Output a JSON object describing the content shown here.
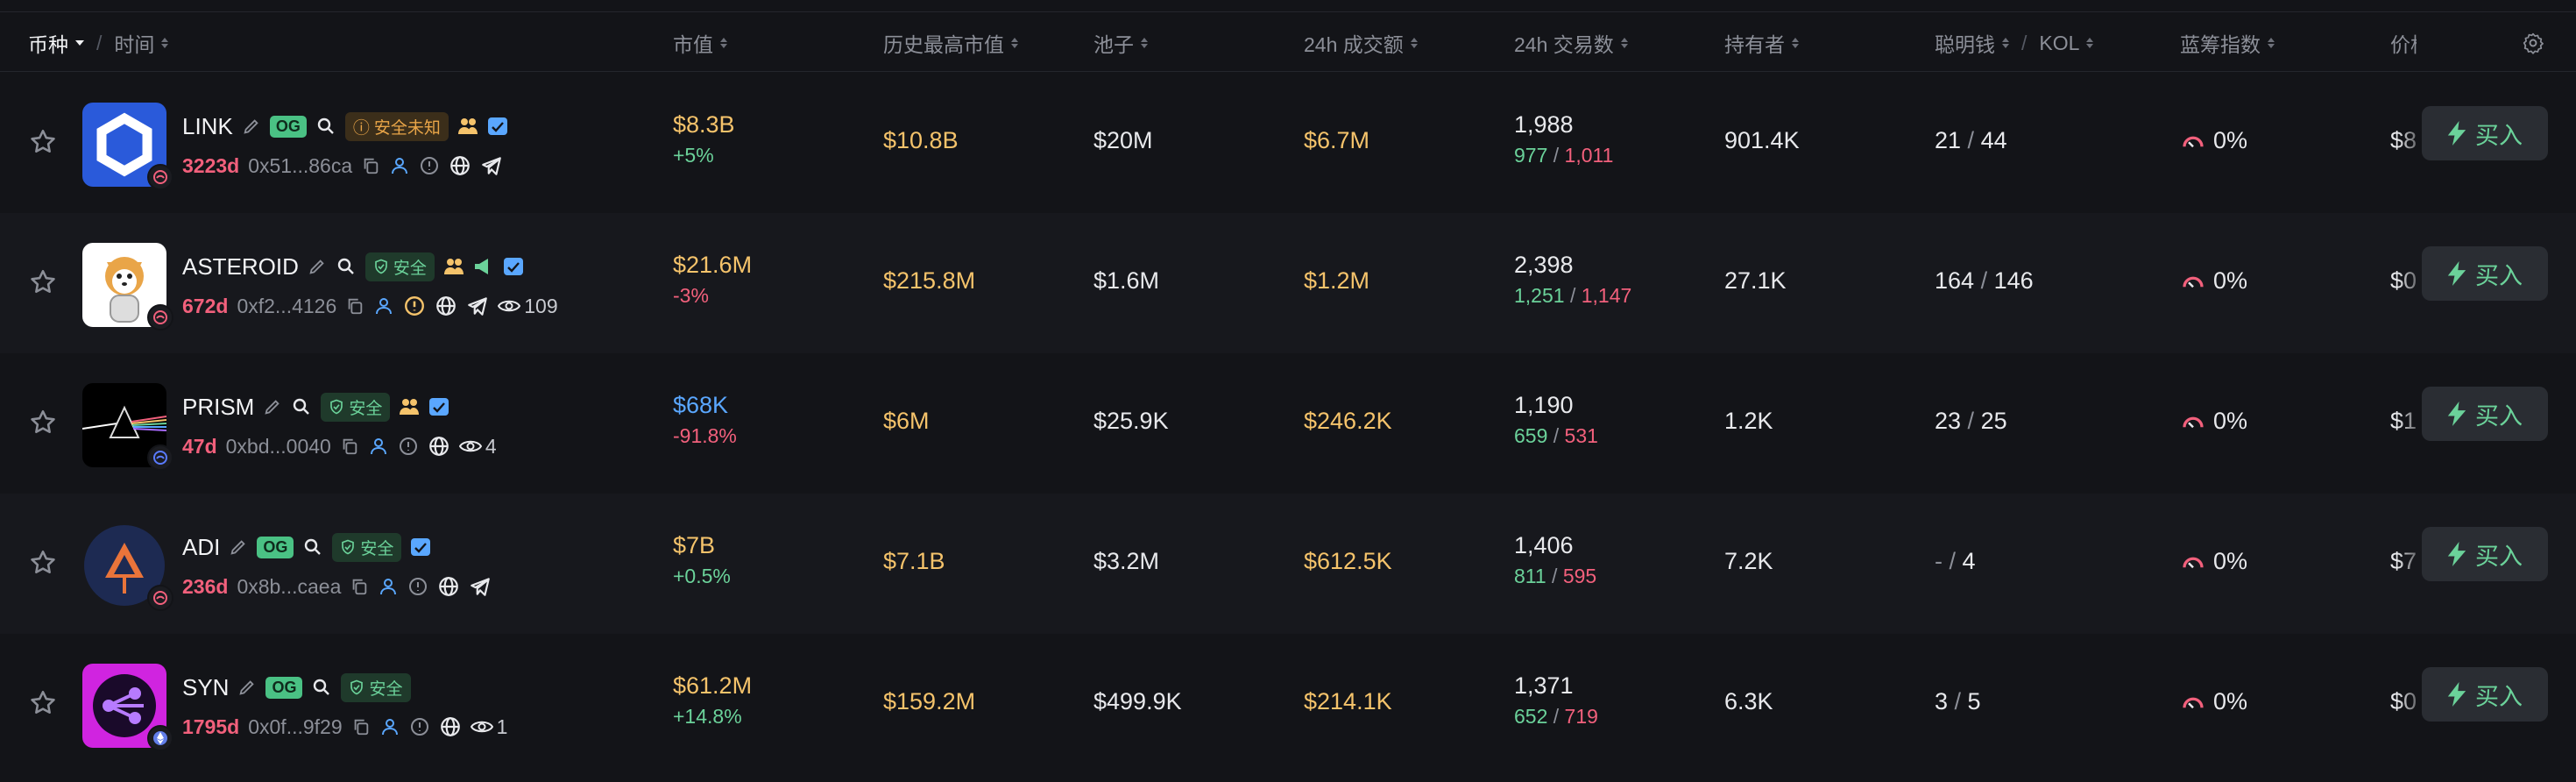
{
  "header": {
    "coin": "币种",
    "time": "时间",
    "slash": "/",
    "mcap": "市值",
    "ath": "历史最高市值",
    "pool": "池子",
    "vol": "24h 成交额",
    "txs": "24h 交易数",
    "holders": "持有者",
    "smart": "聪明钱",
    "kol": "KOL",
    "bluechip": "蓝筹指数",
    "price": "价格"
  },
  "buy_label": "买入",
  "rows": [
    {
      "name": "LINK",
      "og": "OG",
      "security": "安全未知",
      "age": "3223d",
      "addr": "0x51...86ca",
      "mcap": "$8.3B",
      "mcap_change": "+5%",
      "ath": "$10.8B",
      "pool": "$20M",
      "vol": "$6.7M",
      "txs": "1,988",
      "buys": "977",
      "sells": "1,011",
      "holders": "901.4K",
      "smart": "21",
      "kol": "44",
      "bluechip": "0%",
      "price": "$8",
      "views": ""
    },
    {
      "name": "ASTEROID",
      "og": "",
      "security": "安全",
      "age": "672d",
      "addr": "0xf2...4126",
      "mcap": "$21.6M",
      "mcap_change": "-3%",
      "ath": "$215.8M",
      "pool": "$1.6M",
      "vol": "$1.2M",
      "txs": "2,398",
      "buys": "1,251",
      "sells": "1,147",
      "holders": "27.1K",
      "smart": "164",
      "kol": "146",
      "bluechip": "0%",
      "price": "$0",
      "views": "109"
    },
    {
      "name": "PRISM",
      "og": "",
      "security": "安全",
      "age": "47d",
      "addr": "0xbd...0040",
      "mcap": "$68K",
      "mcap_change": "-91.8%",
      "ath": "$6M",
      "pool": "$25.9K",
      "vol": "$246.2K",
      "txs": "1,190",
      "buys": "659",
      "sells": "531",
      "holders": "1.2K",
      "smart": "23",
      "kol": "25",
      "bluechip": "0%",
      "price": "$1",
      "views": "4"
    },
    {
      "name": "ADI",
      "og": "OG",
      "security": "安全",
      "age": "236d",
      "addr": "0x8b...caea",
      "mcap": "$7B",
      "mcap_change": "+0.5%",
      "ath": "$7.1B",
      "pool": "$3.2M",
      "vol": "$612.5K",
      "txs": "1,406",
      "buys": "811",
      "sells": "595",
      "holders": "7.2K",
      "smart": "-",
      "kol": "4",
      "bluechip": "0%",
      "price": "$7",
      "views": ""
    },
    {
      "name": "SYN",
      "og": "OG",
      "security": "安全",
      "age": "1795d",
      "addr": "0x0f...9f29",
      "mcap": "$61.2M",
      "mcap_change": "+14.8%",
      "ath": "$159.2M",
      "pool": "$499.9K",
      "vol": "$214.1K",
      "txs": "1,371",
      "buys": "652",
      "sells": "719",
      "holders": "6.3K",
      "smart": "3",
      "kol": "5",
      "bluechip": "0%",
      "price": "$0",
      "views": "1"
    }
  ],
  "colors": {
    "bg": "#131418",
    "alt_bg": "#17181d",
    "accent_green": "#6bd29a",
    "accent_red": "#f2607c",
    "accent_yellow": "#f5c36b",
    "accent_blue": "#5aa7ff"
  }
}
